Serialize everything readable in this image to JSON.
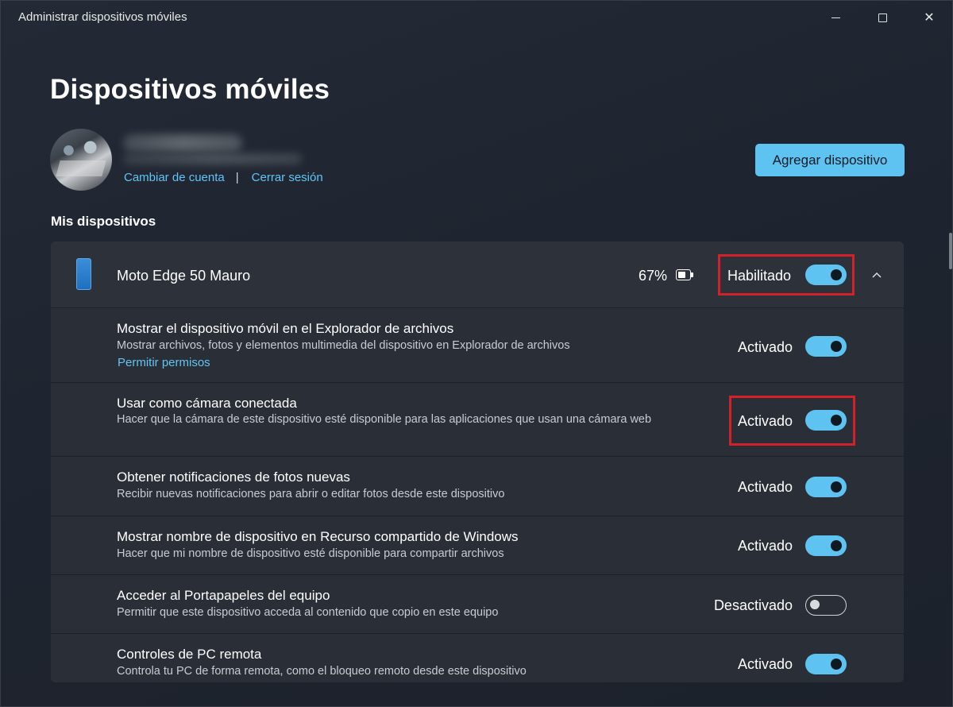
{
  "window": {
    "title": "Administrar dispositivos móviles",
    "close_glyph": "✕"
  },
  "page": {
    "title": "Dispositivos móviles"
  },
  "account": {
    "change_account": "Cambiar de cuenta",
    "separator": "|",
    "sign_out": "Cerrar sesión"
  },
  "add_device_label": "Agregar dispositivo",
  "section_label": "Mis dispositivos",
  "device": {
    "name": "Moto Edge 50 Mauro",
    "battery": "67%",
    "battery_level": 0.67,
    "status": "Habilitado",
    "enabled": true
  },
  "settings": [
    {
      "title": "Mostrar el dispositivo móvil en el Explorador de archivos",
      "description": "Mostrar archivos, fotos y elementos multimedia del dispositivo en Explorador de archivos",
      "link": "Permitir permisos",
      "status": "Activado",
      "on": true
    },
    {
      "title": "Usar como cámara conectada",
      "description": "Hacer que la cámara de este dispositivo esté disponible para las aplicaciones que usan una cámara web",
      "status": "Activado",
      "on": true
    },
    {
      "title": "Obtener notificaciones de fotos nuevas",
      "description": "Recibir nuevas notificaciones para abrir o editar fotos desde este dispositivo",
      "status": "Activado",
      "on": true
    },
    {
      "title": "Mostrar nombre de dispositivo en Recurso compartido de Windows",
      "description": "Hacer que mi nombre de dispositivo esté disponible para compartir archivos",
      "status": "Activado",
      "on": true
    },
    {
      "title": "Acceder al Portapapeles del equipo",
      "description": "Permitir que este dispositivo acceda al contenido que copio en este equipo",
      "status": "Desactivado",
      "on": false
    },
    {
      "title": "Controles de PC remota",
      "description": "Controla tu PC de forma remota, como el bloqueo remoto desde este dispositivo",
      "status": "Activado",
      "on": true
    }
  ],
  "colors": {
    "accent": "#5fc3f2",
    "link": "#62c4f5",
    "highlight": "#d3202b",
    "background": "#1f2530"
  }
}
